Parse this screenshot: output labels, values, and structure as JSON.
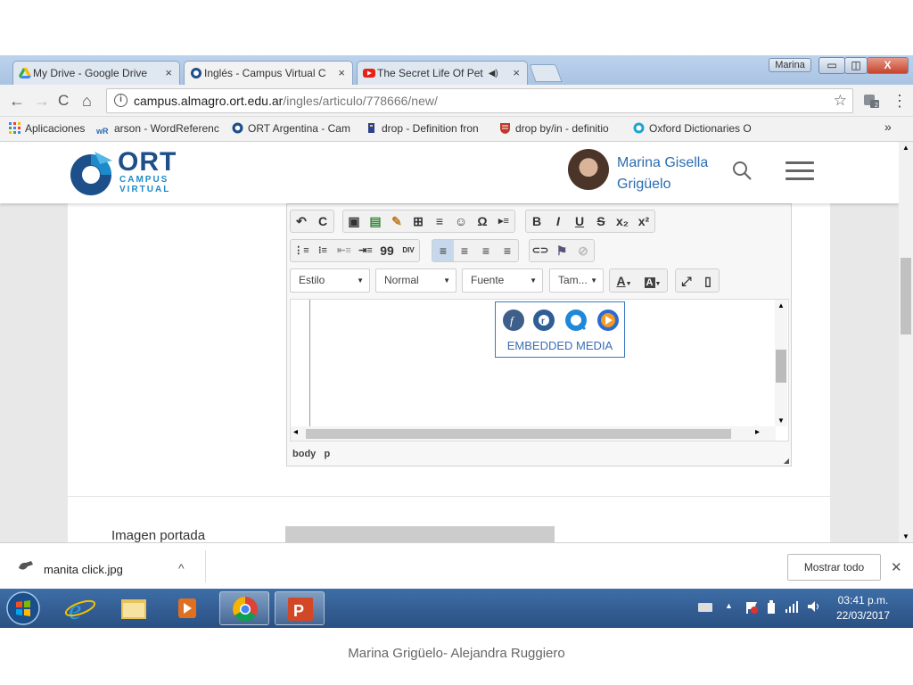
{
  "browser": {
    "tabs": [
      {
        "title": "My Drive - Google Drive",
        "close": "×"
      },
      {
        "title": "Inglés - Campus Virtual C",
        "close": "×"
      },
      {
        "title": "The Secret Life Of Pet",
        "audio": "◀)",
        "close": "×"
      }
    ],
    "profile_chip": "Marina",
    "window_buttons": {
      "minimize": "▭",
      "restore": "◫",
      "close": "X"
    },
    "nav": {
      "back": "←",
      "forward": "→",
      "reload": "C",
      "home": "⌂"
    },
    "address": {
      "host": "campus.almagro.ort.edu.ar",
      "path": "/ingles/articulo/778666/new/",
      "info": "i",
      "star": "☆"
    },
    "menu_glyph": "⋮",
    "bookmarks": [
      {
        "label": "Aplicaciones"
      },
      {
        "label": "arson - WordReferenc"
      },
      {
        "label": "ORT Argentina - Cam"
      },
      {
        "label": "drop - Definition fron"
      },
      {
        "label": "drop by/in - definitio"
      },
      {
        "label": "Oxford Dictionaries O"
      }
    ],
    "bookmarks_more": "»"
  },
  "site": {
    "logo": {
      "brand": "ORT",
      "line1": "CAMPUS",
      "line2": "VIRTUAL"
    },
    "user": {
      "first": "Marina Gisella",
      "last": "Grigüelo"
    }
  },
  "editor": {
    "row1_groups": [
      [
        "↶",
        "C"
      ],
      [
        "▣",
        "▤",
        "✎",
        "⊞",
        "≡",
        "☺",
        "Ω",
        "▸≡"
      ],
      [
        "B",
        "I",
        "U",
        "S",
        "x₂",
        "x²"
      ]
    ],
    "row2_groups": [
      [
        "⋮≡",
        "⁝≡",
        "⇤≡",
        "⇥≡",
        "99",
        "DIV"
      ],
      [
        "≡",
        "≡",
        "≡",
        "≡"
      ],
      [
        "⊂⊃",
        "⚑",
        "⊘"
      ]
    ],
    "combos": {
      "style": "Estilo",
      "format": "Normal",
      "font": "Fuente",
      "size": "Tam..."
    },
    "color_buttons": {
      "text_color": "A",
      "bg_color": "A"
    },
    "extra_buttons": [
      "⤢",
      "▯"
    ],
    "embed_label": "EMBEDDED MEDIA",
    "scroll": {
      "up": "▲",
      "down": "▼",
      "left": "◂",
      "right": "▸"
    },
    "path": [
      "body",
      "p"
    ],
    "resize": "◢"
  },
  "form": {
    "cover_label": "Imagen portada"
  },
  "downloads": {
    "file": "manita click.jpg",
    "chevron": "^",
    "show_all": "Mostrar todo",
    "close": "✕"
  },
  "taskbar": {
    "time": "03:41 p.m.",
    "date": "22/03/2017",
    "tray_arrow": "▲"
  },
  "credit": "Marina Grigüelo- Alejandra Ruggiero",
  "colors": {
    "accent": "#2b6cb0",
    "ort_blue": "#1d4f8a",
    "embed_border": "#3b78c2",
    "taskbar": "#2a5082"
  }
}
